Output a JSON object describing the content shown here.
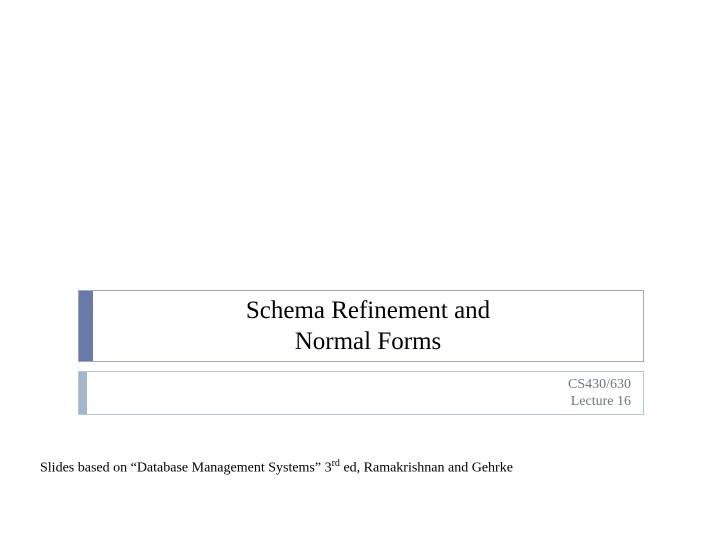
{
  "title": {
    "line1": "Schema Refinement and",
    "line2": "Normal Forms"
  },
  "subtitle": {
    "line1": "CS430/630",
    "line2": "Lecture 16"
  },
  "footer": {
    "prefix": "Slides based on “Database Management Systems” 3",
    "sup": "rd",
    "suffix": " ed, Ramakrishnan and Gehrke"
  }
}
